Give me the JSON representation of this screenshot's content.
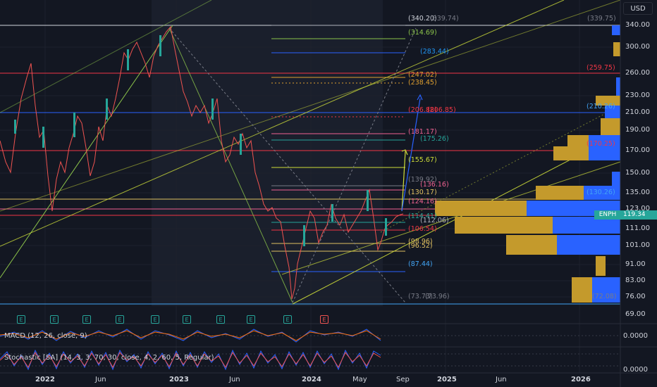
{
  "toolbar": {
    "currency": "USD"
  },
  "symbol": {
    "ticker": "ENPH",
    "last_price": "119.34",
    "color": "#26a69a"
  },
  "price_axis_labels": [
    "340.00",
    "300.00",
    "260.00",
    "230.00",
    "210.00",
    "190.00",
    "170.00",
    "150.00",
    "135.00",
    "123.00",
    "111.00",
    "101.00",
    "91.00",
    "83.00",
    "76.00",
    "69.00"
  ],
  "fib_labels": [
    {
      "text": "(340.20)",
      "color": "#d1d4dc"
    },
    {
      "text": "(339.74)",
      "color": "#787b86"
    },
    {
      "text": "(339.75)",
      "color": "#787b86"
    },
    {
      "text": "(314.69)",
      "color": "#8bc34a"
    },
    {
      "text": "(283.44)",
      "color": "#2196f3"
    },
    {
      "text": "(259.75)",
      "color": "#f23645"
    },
    {
      "text": "(247.02)",
      "color": "#e0a030"
    },
    {
      "text": "(238.45)",
      "color": "#e0a030"
    },
    {
      "text": "(210.26)",
      "color": "#42a5f5"
    },
    {
      "text": "(206.88)",
      "color": "#f23645"
    },
    {
      "text": "(206.85)",
      "color": "#f23645"
    },
    {
      "text": "(181.17)",
      "color": "#f06292"
    },
    {
      "text": "(175.26)",
      "color": "#26a69a"
    },
    {
      "text": "(170.25)",
      "color": "#f23645"
    },
    {
      "text": "(155.67)",
      "color": "#cddc39"
    },
    {
      "text": "(139.92)",
      "color": "#787b86"
    },
    {
      "text": "(136.16)",
      "color": "#f06292"
    },
    {
      "text": "(130.17)",
      "color": "#e0c060"
    },
    {
      "text": "(130.26)",
      "color": "#42a5f5"
    },
    {
      "text": "(124.16)",
      "color": "#f06292"
    },
    {
      "text": "(114.41)",
      "color": "#26a69a"
    },
    {
      "text": "(112.06)",
      "color": "#b2b5be"
    },
    {
      "text": "(106.54)",
      "color": "#f23645"
    },
    {
      "text": "(98.96)",
      "color": "#e0c060"
    },
    {
      "text": "(96.52)",
      "color": "#e0c060"
    },
    {
      "text": "(87.44)",
      "color": "#42a5f5"
    },
    {
      "text": "(73.73)",
      "color": "#787b86"
    },
    {
      "text": "(73.96)",
      "color": "#787b86"
    },
    {
      "text": "(72.08)",
      "color": "#787b86"
    }
  ],
  "event_markers": [
    "E",
    "E",
    "E",
    "E",
    "E",
    "E",
    "E",
    "E",
    "E",
    "E"
  ],
  "indicators": {
    "macd": {
      "label": "MACD (12, 26, close, 9)",
      "value": "0.0000"
    },
    "stoch": {
      "label": "Stochastic [SA] (14, 3, 3, 70, 30, close, 4, 2, 60, 5, Regular)",
      "value": "0.0000"
    }
  },
  "time_axis": [
    "2022",
    "Jun",
    "2023",
    "Jun",
    "2024",
    "May",
    "Sep",
    "2025",
    "Jun",
    "2026"
  ],
  "colors": {
    "background": "#131722",
    "up": "#26a69a",
    "down": "#ef5350",
    "grid": "#1e222d"
  }
}
